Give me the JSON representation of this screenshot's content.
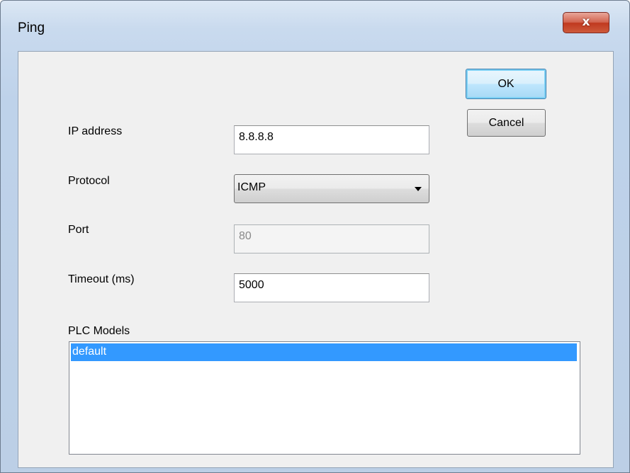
{
  "window": {
    "title": "Ping",
    "close_glyph": "x"
  },
  "buttons": {
    "ok_label": "OK",
    "cancel_label": "Cancel"
  },
  "fields": {
    "ip_address": {
      "label": "IP address",
      "value": "8.8.8.8"
    },
    "protocol": {
      "label": "Protocol",
      "selected": "ICMP"
    },
    "port": {
      "label": "Port",
      "value": "80",
      "enabled": false
    },
    "timeout": {
      "label": "Timeout (ms)",
      "value": "5000"
    }
  },
  "plc_models": {
    "label": "PLC Models",
    "items": [
      "default"
    ],
    "selected_index": 0
  },
  "colors": {
    "selection": "#3399ff",
    "close_button": "#c0391f"
  }
}
